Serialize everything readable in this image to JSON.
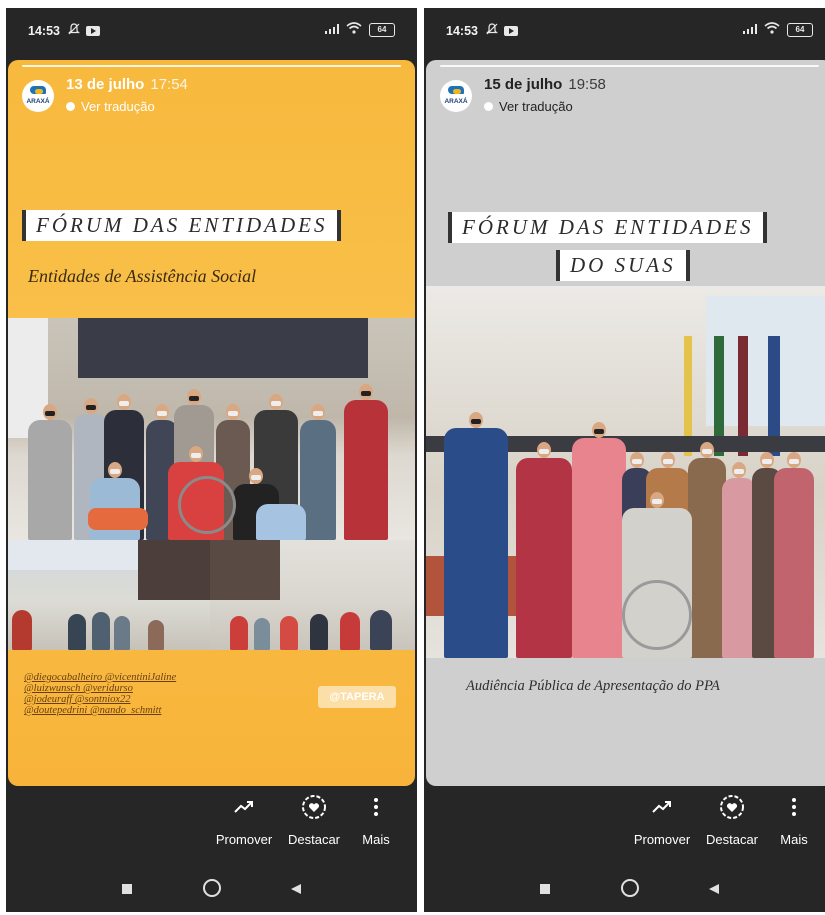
{
  "left": {
    "status": {
      "time": "14:53",
      "battery": "64"
    },
    "story": {
      "avatar_label": "ARAXÁ",
      "date": "13 de julho",
      "time": "17:54",
      "translate": "Ver tradução",
      "title": "FÓRUM DAS ENTIDADES",
      "subtitle": "Entidades de Assistência Social",
      "tags": [
        "@diegocabalheiro @vicentiniJaline",
        "@luizwunsch @veridurso",
        "@jodeuraff @sontniox22",
        "@doutepedrini @nando_schmitt"
      ],
      "tag_badge": "@TAPERA"
    },
    "actions": {
      "promote": "Promover",
      "highlight": "Destacar",
      "more": "Mais"
    }
  },
  "right": {
    "status": {
      "time": "14:53",
      "battery": "64"
    },
    "story": {
      "avatar_label": "ARAXÁ",
      "date": "15 de julho",
      "time": "19:58",
      "translate": "Ver tradução",
      "title_line1": "FÓRUM DAS ENTIDADES",
      "title_line2": "DO SUAS",
      "caption": "Audiência Pública de Apresentação do PPA"
    },
    "actions": {
      "promote": "Promover",
      "highlight": "Destacar",
      "more": "Mais"
    }
  },
  "icons": {
    "promote": "trending-up-icon",
    "highlight": "heart-circle-icon",
    "more": "vertical-dots-icon",
    "nav_recents": "square-icon",
    "nav_home": "circle-icon",
    "nav_back": "triangle-back-icon"
  }
}
